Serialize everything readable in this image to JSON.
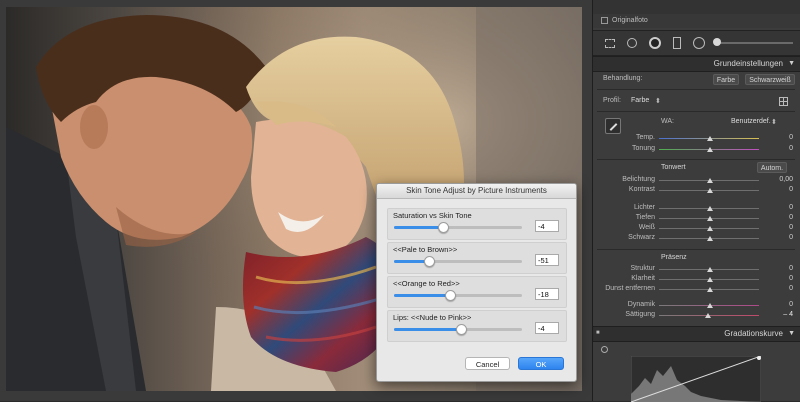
{
  "photo": {
    "description_hidden": ""
  },
  "panel": {
    "originalfoto_label": "Originalfoto",
    "grundeinstellungen_title": "Grundeinstellungen",
    "behandlung_label": "Behandlung:",
    "behandlung_farbe": "Farbe",
    "behandlung_sw": "Schwarzweiß",
    "profil_label": "Profil:",
    "profil_value": "Farbe",
    "wa_label": "WA:",
    "wa_value": "Benutzerdef.",
    "temp_label": "Temp.",
    "temp_value": "0",
    "tonung_label": "Tonung",
    "tonung_value": "0",
    "tonwert_label": "Tonwert",
    "autom_label": "Autom.",
    "belichtung_label": "Belichtung",
    "belichtung_value": "0,00",
    "kontrast_label": "Kontrast",
    "kontrast_value": "0",
    "lichter_label": "Lichter",
    "lichter_value": "0",
    "tiefen_label": "Tiefen",
    "tiefen_value": "0",
    "weiss_label": "Weiß",
    "weiss_value": "0",
    "schwarz_label": "Schwarz",
    "schwarz_value": "0",
    "praesenz_label": "Präsenz",
    "struktur_label": "Struktur",
    "struktur_value": "0",
    "klarheit_label": "Klarheit",
    "klarheit_value": "0",
    "dunst_label": "Dunst entfernen",
    "dunst_value": "0",
    "dynamik_label": "Dynamik",
    "dynamik_value": "0",
    "saettigung_label": "Sättigung",
    "saettigung_value": "– 4",
    "gradationskurve_title": "Gradationskurve"
  },
  "dialog": {
    "title": "Skin Tone Adjust by Picture Instruments",
    "sliders": [
      {
        "label": "Saturation vs Skin Tone",
        "value": "-4",
        "position": 0.38
      },
      {
        "label": "<<Pale  to  Brown>>",
        "value": "-51",
        "position": 0.27
      },
      {
        "label": "<<Orange  to  Red>>",
        "value": "-18",
        "position": 0.44
      },
      {
        "label": "Lips:  <<Nude  to  Pink>>",
        "value": "-4",
        "position": 0.52
      }
    ],
    "cancel_label": "Cancel",
    "ok_label": "OK"
  },
  "colors": {
    "accent": "#3b8ee8",
    "panel_bg": "#3c3c3c",
    "dialog_bg": "#e8e8e8"
  },
  "icons": {
    "eyedropper": "eyedropper-icon",
    "grid": "profile-grid-icon",
    "crop": "crop-tool-icon",
    "spot": "spot-removal-icon",
    "redeye": "redeye-icon",
    "gradient": "graduated-filter-icon",
    "radial": "radial-filter-icon",
    "brush": "brush-icon",
    "curve_target": "target-adjust-icon"
  }
}
